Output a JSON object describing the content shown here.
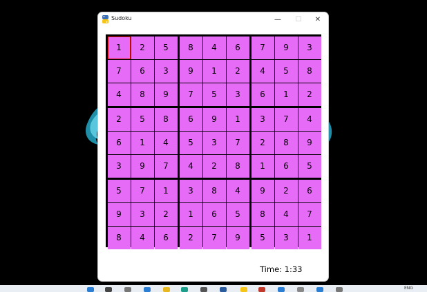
{
  "window": {
    "title": "Sudoku",
    "minimize_glyph": "—",
    "maximize_glyph": "☐",
    "close_glyph": "✕"
  },
  "board": {
    "cell_color": "#e66bf6",
    "selected_cell": [
      0,
      0
    ],
    "grid": [
      [
        1,
        2,
        5,
        8,
        4,
        6,
        7,
        9,
        3
      ],
      [
        7,
        6,
        3,
        9,
        1,
        2,
        4,
        5,
        8
      ],
      [
        4,
        8,
        9,
        7,
        5,
        3,
        6,
        1,
        2
      ],
      [
        2,
        5,
        8,
        6,
        9,
        1,
        3,
        7,
        4
      ],
      [
        6,
        1,
        4,
        5,
        3,
        7,
        2,
        8,
        9
      ],
      [
        3,
        9,
        7,
        4,
        2,
        8,
        1,
        6,
        5
      ],
      [
        5,
        7,
        1,
        3,
        8,
        4,
        9,
        2,
        6
      ],
      [
        9,
        3,
        2,
        1,
        6,
        5,
        8,
        4,
        7
      ],
      [
        8,
        4,
        6,
        2,
        7,
        9,
        5,
        3,
        1
      ]
    ]
  },
  "timer": {
    "text": "Time:  1:33"
  },
  "taskbar": {
    "language": "ENG"
  }
}
